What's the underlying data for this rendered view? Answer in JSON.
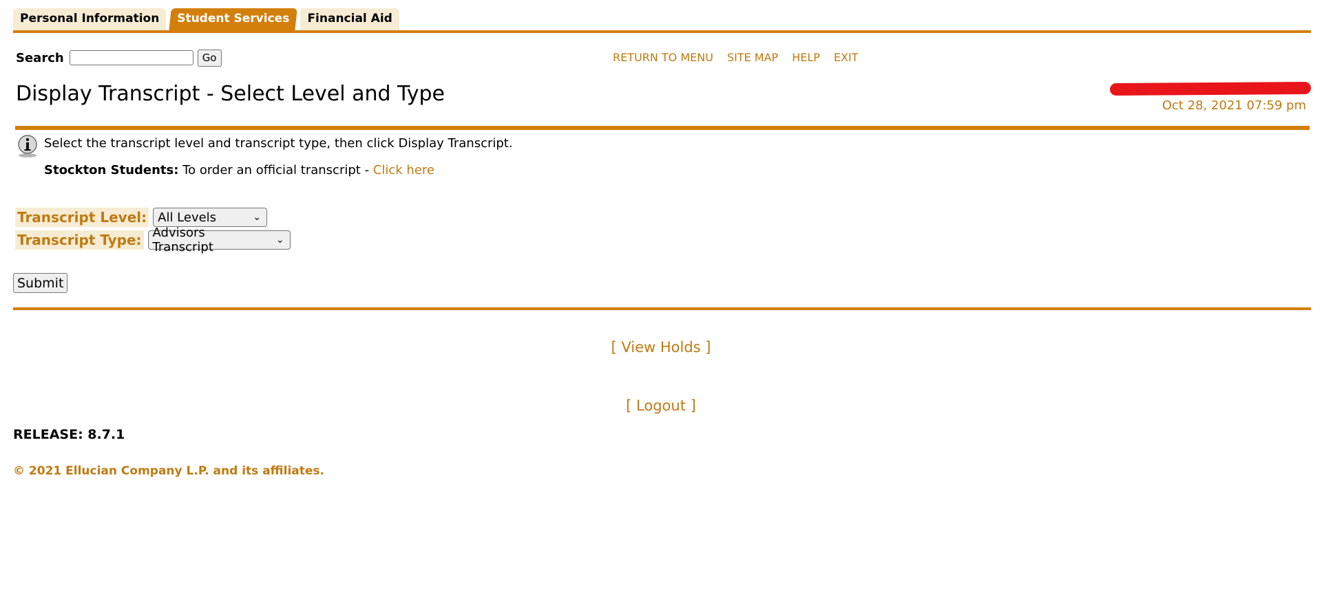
{
  "tabs": [
    {
      "label": "Personal Information",
      "active": false
    },
    {
      "label": "Student Services",
      "active": true
    },
    {
      "label": "Financial Aid",
      "active": false
    }
  ],
  "search": {
    "label": "Search",
    "value": "",
    "go_label": "Go"
  },
  "toplinks": [
    "RETURN TO MENU",
    "SITE MAP",
    "HELP",
    "EXIT"
  ],
  "page_title": "Display Transcript - Select Level and Type",
  "timestamp": "Oct 28, 2021 07:59 pm",
  "info": {
    "text": "Select the transcript level and transcript type, then click Display Transcript.",
    "stockton_bold": "Stockton Students:",
    "stockton_text": " To order an official transcript - ",
    "stockton_link": "Click here"
  },
  "form": {
    "level_label": "Transcript Level:",
    "level_value": "All Levels",
    "type_label": "Transcript Type:",
    "type_value": "Advisors Transcript",
    "submit_label": "Submit"
  },
  "footer_links": {
    "view_holds": "[ View Holds ]",
    "logout": "[ Logout ]"
  },
  "release": "RELEASE: 8.7.1",
  "copyright": "© 2021 Ellucian Company L.P. and its affiliates.",
  "colors": {
    "accent": "#d37f0b",
    "link": "#c07a12",
    "tab_bg": "#f6ecd3",
    "redaction": "#e8151b"
  }
}
